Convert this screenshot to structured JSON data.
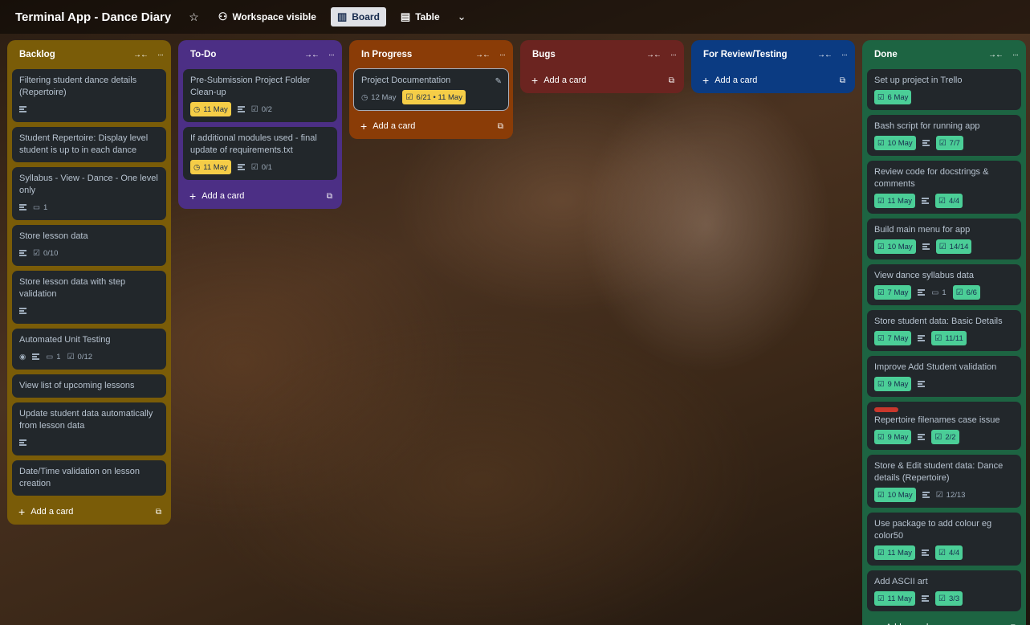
{
  "header": {
    "board_title": "Terminal App - Dance Diary",
    "visibility": "Workspace visible",
    "view_board": "Board",
    "view_table": "Table"
  },
  "add_card_label": "Add a card",
  "lists": [
    {
      "title": "Backlog",
      "color": "#7a5c08",
      "cards": [
        {
          "title": "Filtering student dance details (Repertoire)",
          "badges": [
            {
              "type": "desc"
            }
          ]
        },
        {
          "title": "Student Repertoire: Display level student is up to in each dance",
          "badges": []
        },
        {
          "title": "Syllabus - View - Dance - One level only",
          "badges": [
            {
              "type": "desc"
            },
            {
              "type": "comments",
              "text": "1"
            }
          ]
        },
        {
          "title": "Store lesson data",
          "badges": [
            {
              "type": "desc"
            },
            {
              "type": "checklist",
              "text": "0/10"
            }
          ]
        },
        {
          "title": "Store lesson data with step validation",
          "badges": [
            {
              "type": "desc"
            }
          ]
        },
        {
          "title": "Automated Unit Testing",
          "badges": [
            {
              "type": "watch"
            },
            {
              "type": "desc"
            },
            {
              "type": "comments",
              "text": "1"
            },
            {
              "type": "checklist",
              "text": "0/12"
            }
          ]
        },
        {
          "title": "View list of upcoming lessons",
          "badges": []
        },
        {
          "title": "Update student data automatically from lesson data",
          "badges": [
            {
              "type": "desc"
            }
          ]
        },
        {
          "title": "Date/Time validation on lesson creation",
          "badges": []
        }
      ]
    },
    {
      "title": "To-Do",
      "color": "#4c2f85",
      "cards": [
        {
          "title": "Pre-Submission Project Folder Clean-up",
          "badges": [
            {
              "type": "date-yellow",
              "text": "11 May"
            },
            {
              "type": "desc"
            },
            {
              "type": "checklist",
              "text": "0/2"
            }
          ]
        },
        {
          "title": "If additional modules used - final update of requirements.txt",
          "badges": [
            {
              "type": "date-yellow",
              "text": "11 May"
            },
            {
              "type": "desc"
            },
            {
              "type": "checklist",
              "text": "0/1"
            }
          ]
        }
      ]
    },
    {
      "title": "In Progress",
      "color": "#8a3c07",
      "cards": [
        {
          "title": "Project Documentation",
          "selected": true,
          "badges": [
            {
              "type": "date",
              "text": "12 May"
            },
            {
              "type": "range-yellow",
              "text": "6/21 • 11 May"
            }
          ]
        }
      ]
    },
    {
      "title": "Bugs",
      "color": "#6b2420",
      "cards": []
    },
    {
      "title": "For Review/Testing",
      "color": "#0b3b82",
      "cards": []
    },
    {
      "title": "Done",
      "color": "#1d6442",
      "cards": [
        {
          "title": "Set up project in Trello",
          "badges": [
            {
              "type": "date-green",
              "text": "6 May"
            }
          ]
        },
        {
          "title": "Bash script for running app",
          "badges": [
            {
              "type": "date-green",
              "text": "10 May"
            },
            {
              "type": "desc"
            },
            {
              "type": "check-green",
              "text": "7/7"
            }
          ]
        },
        {
          "title": "Review code for docstrings & comments",
          "badges": [
            {
              "type": "date-green",
              "text": "11 May"
            },
            {
              "type": "desc"
            },
            {
              "type": "check-green",
              "text": "4/4"
            }
          ]
        },
        {
          "title": "Build main menu for app",
          "badges": [
            {
              "type": "date-green",
              "text": "10 May"
            },
            {
              "type": "desc"
            },
            {
              "type": "check-green",
              "text": "14/14"
            }
          ]
        },
        {
          "title": "View dance syllabus data",
          "badges": [
            {
              "type": "date-green",
              "text": "7 May"
            },
            {
              "type": "desc"
            },
            {
              "type": "comments",
              "text": "1"
            },
            {
              "type": "check-green",
              "text": "6/6"
            }
          ]
        },
        {
          "title": "Store student data: Basic Details",
          "badges": [
            {
              "type": "date-green",
              "text": "7 May"
            },
            {
              "type": "desc"
            },
            {
              "type": "check-green",
              "text": "11/11"
            }
          ]
        },
        {
          "title": "Improve Add Student validation",
          "badges": [
            {
              "type": "date-green",
              "text": "9 May"
            },
            {
              "type": "desc"
            }
          ]
        },
        {
          "title": "Repertoire filenames case issue",
          "label": "red",
          "badges": [
            {
              "type": "date-green",
              "text": "9 May"
            },
            {
              "type": "desc"
            },
            {
              "type": "check-green",
              "text": "2/2"
            }
          ]
        },
        {
          "title": "Store & Edit student data: Dance details (Repertoire)",
          "badges": [
            {
              "type": "date-green",
              "text": "10 May"
            },
            {
              "type": "desc"
            },
            {
              "type": "checklist",
              "text": "12/13"
            }
          ]
        },
        {
          "title": "Use package to add colour eg color50",
          "badges": [
            {
              "type": "date-green",
              "text": "11 May"
            },
            {
              "type": "desc"
            },
            {
              "type": "check-green",
              "text": "4/4"
            }
          ]
        },
        {
          "title": "Add ASCII art",
          "badges": [
            {
              "type": "date-green",
              "text": "11 May"
            },
            {
              "type": "desc"
            },
            {
              "type": "check-green",
              "text": "3/3"
            }
          ]
        }
      ]
    }
  ]
}
